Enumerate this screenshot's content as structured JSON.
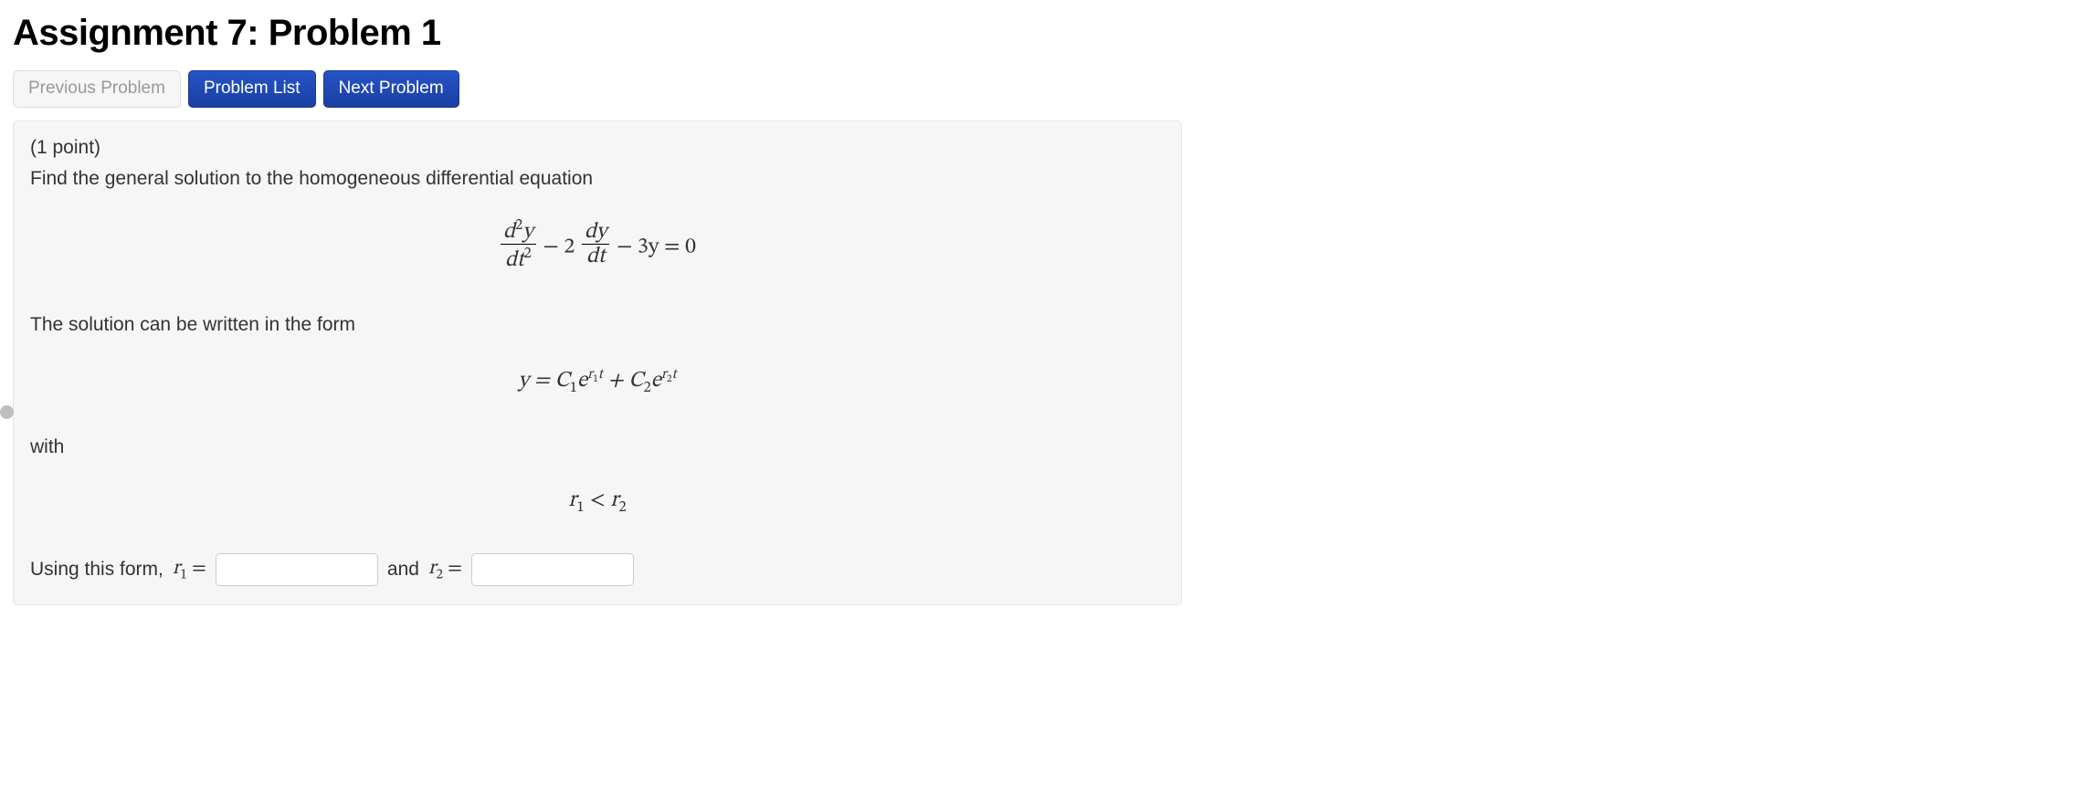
{
  "title": "Assignment 7: Problem 1",
  "nav": {
    "prev": "Previous Problem",
    "list": "Problem List",
    "next": "Next Problem"
  },
  "problem": {
    "points": "(1 point)",
    "prompt": "Find the general solution to the homogeneous differential equation",
    "form_intro": "The solution can be written in the form",
    "with_text": "with",
    "answer_lead": "Using this form, ",
    "and_text": " and ",
    "r1_value": "",
    "r2_value": ""
  },
  "math": {
    "eq_d2y": "d",
    "eq_y": "y",
    "eq_dt2": "dt",
    "eq_minus2": " − 2",
    "eq_dy": "dy",
    "eq_dt": "dt",
    "eq_tail": " − 3y = 0",
    "sol_lhs": "y = C",
    "sol_e": "e",
    "sol_plusC": " + C",
    "ineq_r1": "r",
    "ineq_lt": " < ",
    "ineq_r2": "r",
    "r1_label_pre": "r",
    "r1_label_eq": " = ",
    "r2_label_pre": "r",
    "r2_label_eq": " = "
  }
}
